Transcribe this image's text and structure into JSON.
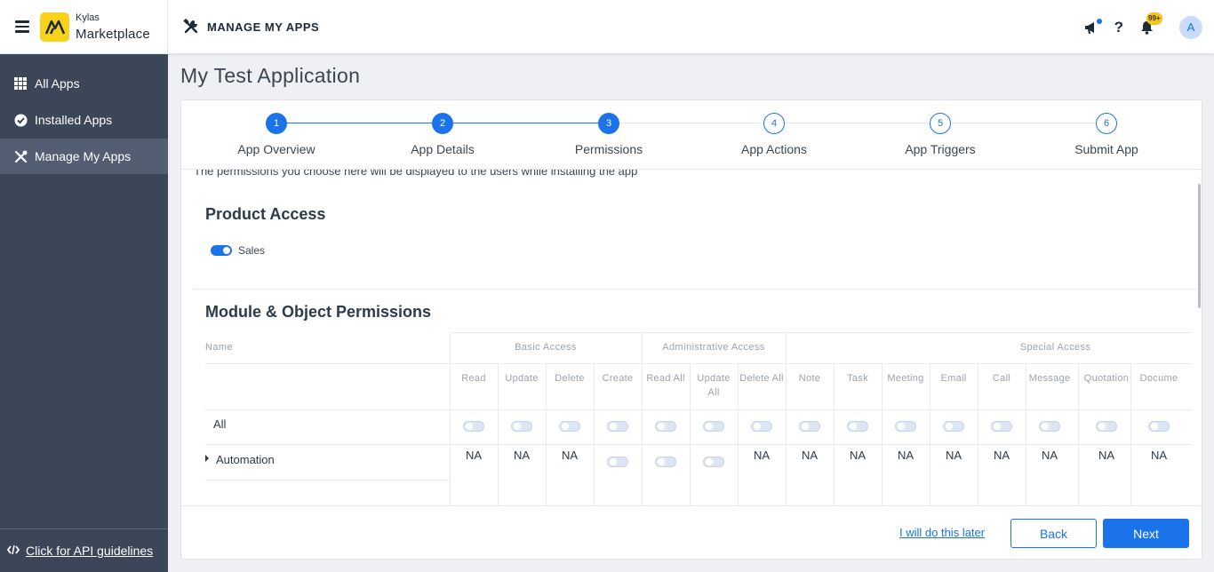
{
  "header": {
    "brand_small": "Kylas",
    "brand_big": "Marketplace",
    "section_title": "MANAGE MY APPS",
    "help_label": "?",
    "notification_badge": "99+",
    "avatar_initial": "A"
  },
  "sidebar": {
    "items": [
      {
        "label": "All Apps",
        "icon": "grid-icon"
      },
      {
        "label": "Installed Apps",
        "icon": "check-circle-icon"
      },
      {
        "label": "Manage My Apps",
        "icon": "tools-icon"
      }
    ],
    "footer_link": "Click for API guidelines"
  },
  "page": {
    "title": "My Test Application"
  },
  "stepper": {
    "steps": [
      {
        "num": "1",
        "label": "App Overview",
        "state": "done"
      },
      {
        "num": "2",
        "label": "App Details",
        "state": "done"
      },
      {
        "num": "3",
        "label": "Permissions",
        "state": "done"
      },
      {
        "num": "4",
        "label": "App Actions",
        "state": "todo"
      },
      {
        "num": "5",
        "label": "App Triggers",
        "state": "todo"
      },
      {
        "num": "6",
        "label": "Submit App",
        "state": "todo"
      }
    ]
  },
  "permissions": {
    "intro": "The permissions you choose here will be displayed to the users while installing the app",
    "product_access_title": "Product Access",
    "product_toggle_label": "Sales",
    "module_title": "Module & Object Permissions",
    "table": {
      "name_header": "Name",
      "group_basic": "Basic Access",
      "group_admin": "Administrative Access",
      "group_special": "Special Access",
      "columns": [
        "Read",
        "Update",
        "Delete",
        "Create",
        "Read All",
        "Update All",
        "Delete All",
        "Note",
        "Task",
        "Meeting",
        "Email",
        "Call",
        "Message",
        "Quotation",
        "Docume"
      ],
      "rows": [
        {
          "name": "All",
          "cells": [
            "toggle",
            "toggle",
            "toggle",
            "toggle",
            "toggle",
            "toggle",
            "toggle",
            "toggle",
            "toggle",
            "toggle",
            "toggle",
            "toggle",
            "toggle",
            "toggle",
            "toggle"
          ]
        },
        {
          "name": "Automation",
          "cells": [
            "NA",
            "NA",
            "NA",
            "toggle",
            "toggle",
            "toggle",
            "NA",
            "NA",
            "NA",
            "NA",
            "NA",
            "NA",
            "NA",
            "NA",
            "NA"
          ]
        }
      ]
    }
  },
  "footer": {
    "later_link": "I will do this later",
    "back_label": "Back",
    "next_label": "Next"
  },
  "colors": {
    "primary": "#1a73e8",
    "sidebar_bg": "#3c4659",
    "sidebar_active": "#535e73",
    "logo_yellow": "#f8d21b"
  }
}
